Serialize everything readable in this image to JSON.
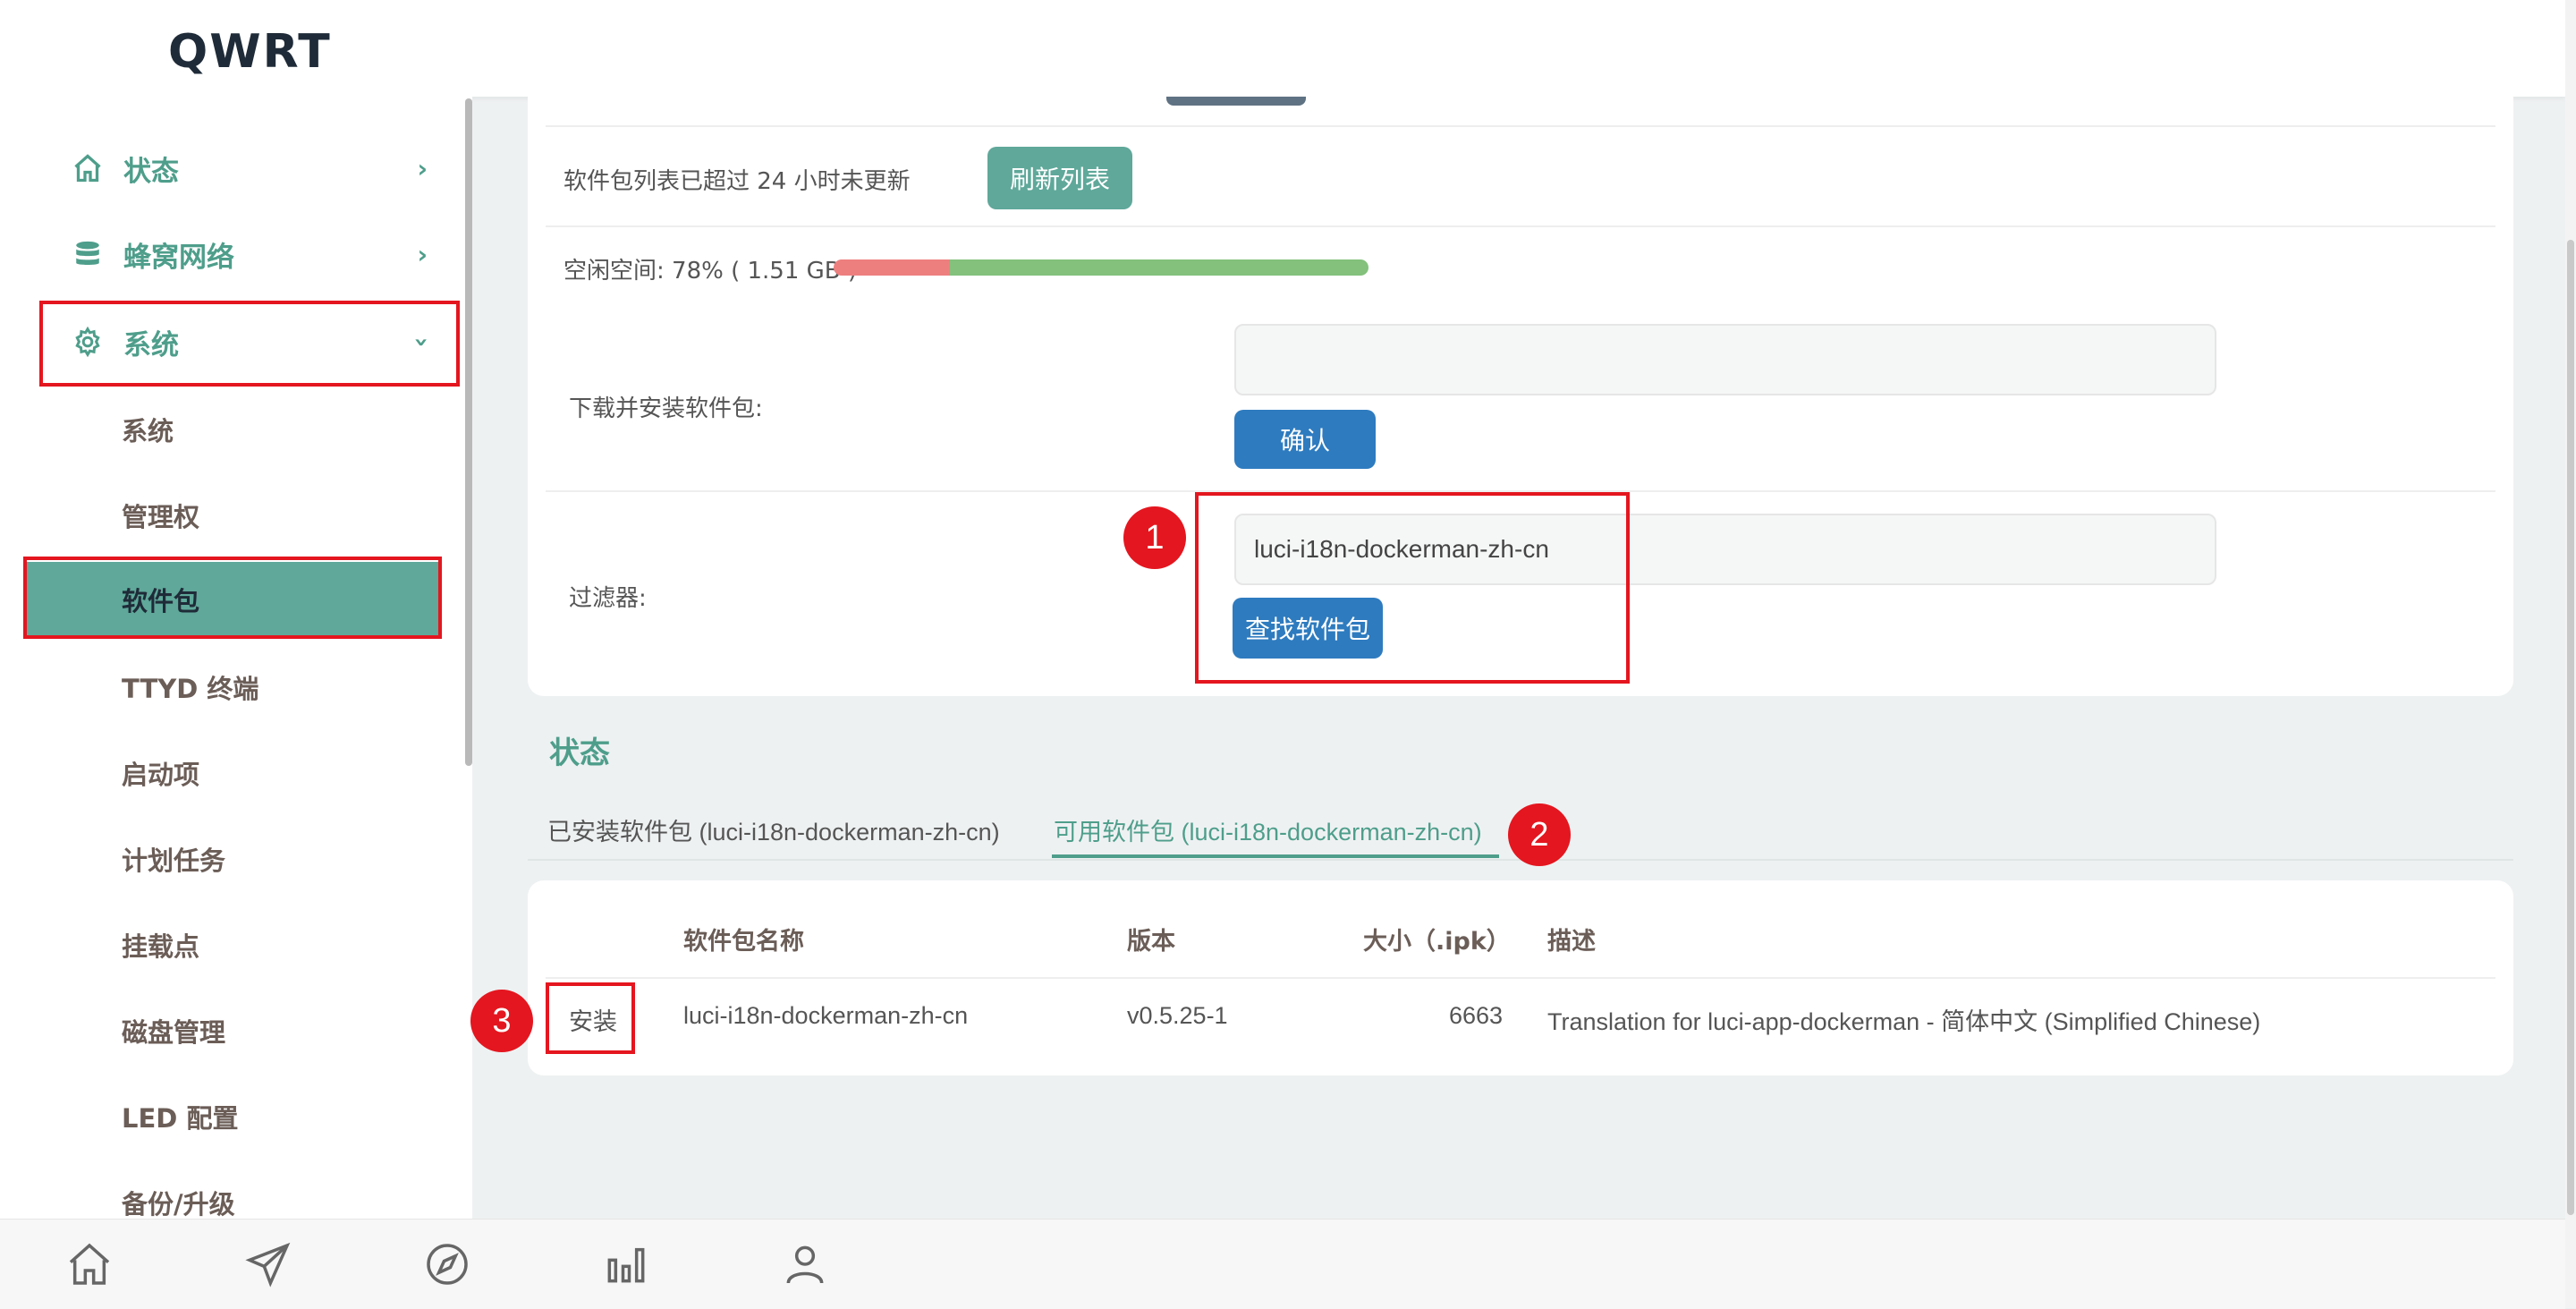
{
  "header": {
    "brand": "QWRT"
  },
  "sidebar": {
    "items": [
      {
        "label": "状态",
        "icon": "home-icon"
      },
      {
        "label": "蜂窝网络",
        "icon": "database-icon"
      },
      {
        "label": "系统",
        "icon": "gear-icon"
      }
    ],
    "sub_items": [
      "系统",
      "管理权",
      "软件包",
      "TTYD 终端",
      "启动项",
      "计划任务",
      "挂载点",
      "磁盘管理",
      "LED 配置",
      "备份/升级"
    ],
    "active_sub": "软件包"
  },
  "packages": {
    "update_notice": "软件包列表已超过 24 小时未更新",
    "refresh_label": "刷新列表",
    "free_space": "空闲空间: 78% ( 1.51 GB )",
    "free_space_percent": 78,
    "used_percent": 22,
    "download_label": "下载并安装软件包:",
    "download_value": "",
    "confirm_label": "确认",
    "filter_label": "过滤器:",
    "filter_value": "luci-i18n-dockerman-zh-cn",
    "find_label": "查找软件包"
  },
  "status": {
    "title": "状态",
    "tabs": [
      {
        "label": "已安装软件包 (luci-i18n-dockerman-zh-cn)",
        "active": false
      },
      {
        "label": "可用软件包 (luci-i18n-dockerman-zh-cn)",
        "active": true
      }
    ]
  },
  "table": {
    "headers": [
      "软件包名称",
      "版本",
      "大小（.ipk）",
      "描述"
    ],
    "rows": [
      {
        "action": "安装",
        "name": "luci-i18n-dockerman-zh-cn",
        "version": "v0.5.25-1",
        "size": "6663",
        "description": "Translation for luci-app-dockerman - 简体中文 (Simplified Chinese)"
      }
    ]
  },
  "markers": [
    "1",
    "2",
    "3"
  ],
  "colors": {
    "accent": "#5fa89a",
    "primary": "#2e7bbf",
    "highlight": "#e4161f"
  },
  "bottom_nav": [
    "home-icon",
    "send-icon",
    "compass-icon",
    "bar-chart-icon",
    "user-icon"
  ]
}
